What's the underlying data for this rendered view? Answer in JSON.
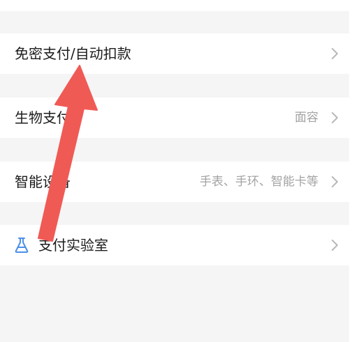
{
  "settings": {
    "rows": [
      {
        "label": "免密支付/自动扣款",
        "value": "",
        "icon": "chevron-right-icon"
      },
      {
        "label": "生物支付",
        "value": "面容",
        "icon": "chevron-right-icon"
      },
      {
        "label": "智能设备",
        "value": "手表、手环、智能卡等",
        "icon": "chevron-right-icon"
      },
      {
        "label": "支付实验室",
        "value": "",
        "leading_icon": "flask-icon",
        "icon": "chevron-right-icon"
      }
    ]
  },
  "colors": {
    "page_background": "#f5f5f5",
    "card_background": "#ffffff",
    "primary_text": "#1c1c1c",
    "secondary_text": "#a3a3a3",
    "chevron": "#b8b8b8",
    "lab_icon": "#4b8fe8",
    "annotation_arrow": "#f05a55"
  }
}
